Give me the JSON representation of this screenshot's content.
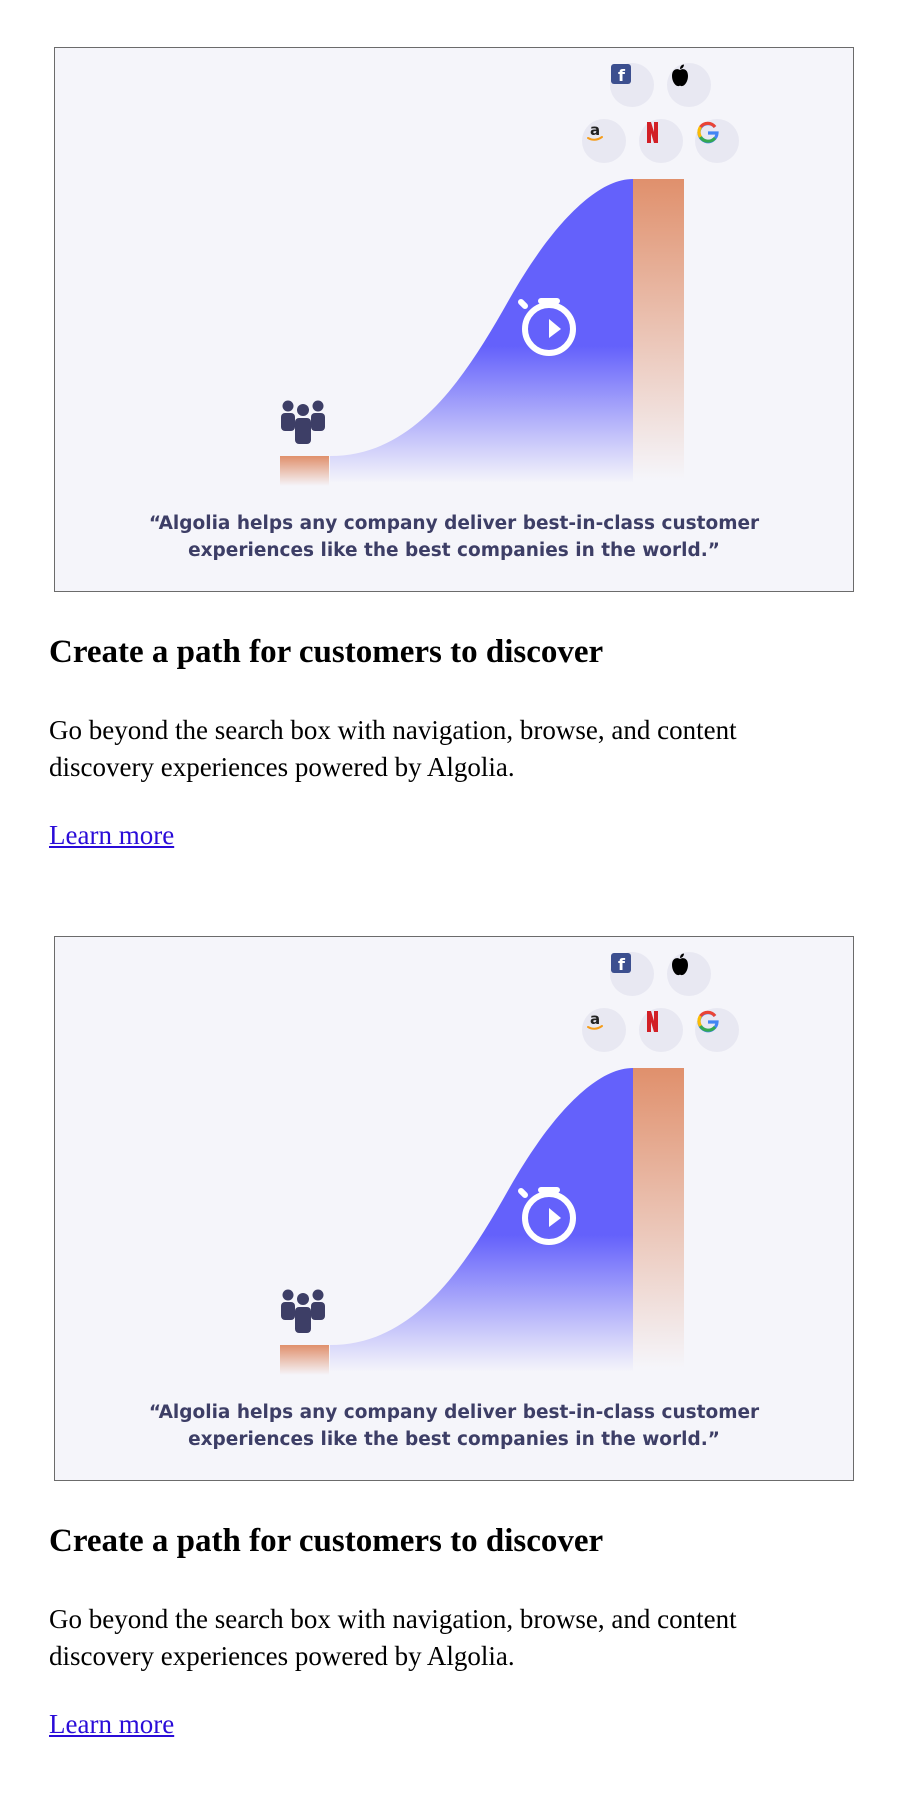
{
  "sections": [
    {
      "quote_line1": "“Algolia helps any company deliver best-in-class customer",
      "quote_line2": "experiences like the best companies in the world.”",
      "heading": "Create a path for customers to discover",
      "body": "Go beyond the search box with navigation, browse, and content discovery experiences powered by Algolia.",
      "link_label": "Learn more"
    },
    {
      "quote_line1": "“Algolia helps any company deliver best-in-class customer",
      "quote_line2": "experiences like the best companies in the world.”",
      "heading": "Create a path for customers to discover",
      "body": "Go beyond the search box with navigation, browse, and content discovery experiences powered by Algolia.",
      "link_label": "Learn more"
    }
  ],
  "logos": {
    "facebook": "f",
    "amazon": "a",
    "netflix": "N",
    "google": "G"
  },
  "colors": {
    "curve": "#6461fb",
    "bar": "#e0906c",
    "ink": "#3d3e66",
    "background": "#f5f5fa",
    "link": "#2a0cd8"
  },
  "icons": [
    "team-icon",
    "stopwatch-icon",
    "facebook-icon",
    "apple-icon",
    "amazon-icon",
    "netflix-icon",
    "google-icon"
  ]
}
